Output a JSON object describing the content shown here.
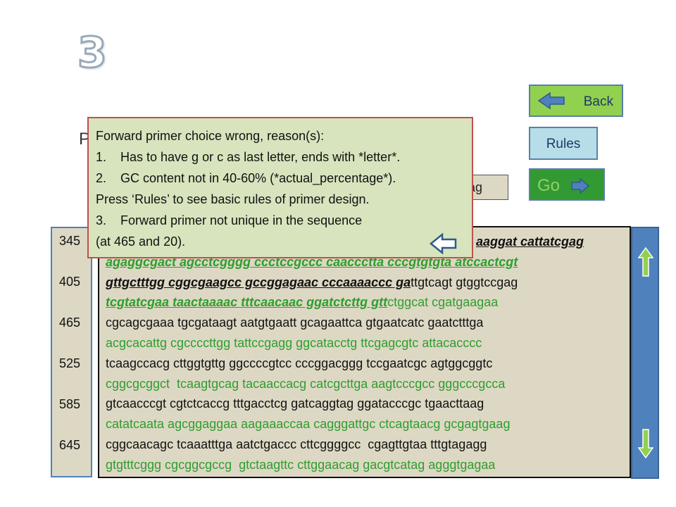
{
  "slide_number": "3",
  "buttons": {
    "back": "Back",
    "rules": "Rules",
    "go": "Go"
  },
  "hidden_label": "P",
  "primer_field_value": "ag",
  "line_numbers": [
    "345",
    "405",
    "465",
    "525",
    "585",
    "645"
  ],
  "sequence_lines": [
    [
      {
        "t": "aaggat cattatcgag",
        "s": "hl-black"
      }
    ],
    [
      {
        "t": "agaggcgact agcctcgggg ccctccgccc caaccctta cccgtgtgta atccactcgt",
        "s": "hl-green"
      }
    ],
    [
      {
        "t": "gttgctttgg cggcgaagcc gccggagaac cccaaaaccc ga",
        "s": "hl-black"
      },
      {
        "t": "ttgtcagt gtggtccgag",
        "s": "black"
      }
    ],
    [
      {
        "t": "tcgtatcgaa taactaaaac tttcaacaac ggatctcttg gtt",
        "s": "hl-green"
      },
      {
        "t": "ctggcat cgatgaagaa",
        "s": "green"
      }
    ],
    [
      {
        "t": "cgcagcgaaa tgcgataagt aatgtgaatt gcagaattca gtgaatcatc gaatctttga",
        "s": "black"
      }
    ],
    [
      {
        "t": "acgcacattg cgccccttgg tattccgagg ggcatacctg ttcgagcgtc attacacccc",
        "s": "green"
      }
    ],
    [
      {
        "t": "tcaagccacg cttggtgttg ggccccgtcc cccggacggg tccgaatcgc agtggcggtc",
        "s": "black"
      }
    ],
    [
      {
        "t": "cggcgcggct  tcaagtgcag tacaaccacg catcgcttga aagtcccgcc gggcccgcca",
        "s": "green"
      }
    ],
    [
      {
        "t": "gtcaacccgt cgtctcaccg tttgacctcg gatcaggtag ggatacccgc tgaacttaag",
        "s": "black"
      }
    ],
    [
      {
        "t": "catatcaata agcggaggaa aagaaaccaa cagggattgc ctcagtaacg gcgagtgaag",
        "s": "green"
      }
    ],
    [
      {
        "t": "cggcaacagc tcaaatttga aatctgaccc cttcggggcc  cgagttgtaa tttgtagagg",
        "s": "black"
      }
    ],
    [
      {
        "t": "gtgtttcggg cgcggcgccg  gtctaagttc cttggaacag gacgtcatag agggtgagaa",
        "s": "green"
      }
    ]
  ],
  "popup": {
    "title": "Forward primer choice wrong, reason(s):",
    "item1_num": "1.",
    "item1_text": "Has to have g or c as last letter, ends with *letter*.",
    "item2_num": "2.",
    "item2_text": "GC content not in 40-60% (*actual_percentage*).",
    "note": "Press ‘Rules’ to see basic rules of primer design.",
    "item3_num": "3.",
    "item3_text": "Forward primer not unique in the sequence",
    "item3_cont": "(at 465 and 20)."
  },
  "colors": {
    "background": "#ffffff",
    "panel_fill": "#ddd8c4",
    "panel_border": "#4f81bd",
    "popup_fill": "#d7e4bd",
    "popup_border": "#c0504d",
    "seq_green": "#2e9e2e",
    "back_button": "#92d050",
    "rules_button": "#b7dee8",
    "go_button": "#339933"
  },
  "icons": {
    "back": "left-arrow-icon",
    "go": "right-arrow-icon",
    "scroll_up": "up-arrow-icon",
    "scroll_down": "down-arrow-icon",
    "popup_close": "left-arrow-icon"
  }
}
